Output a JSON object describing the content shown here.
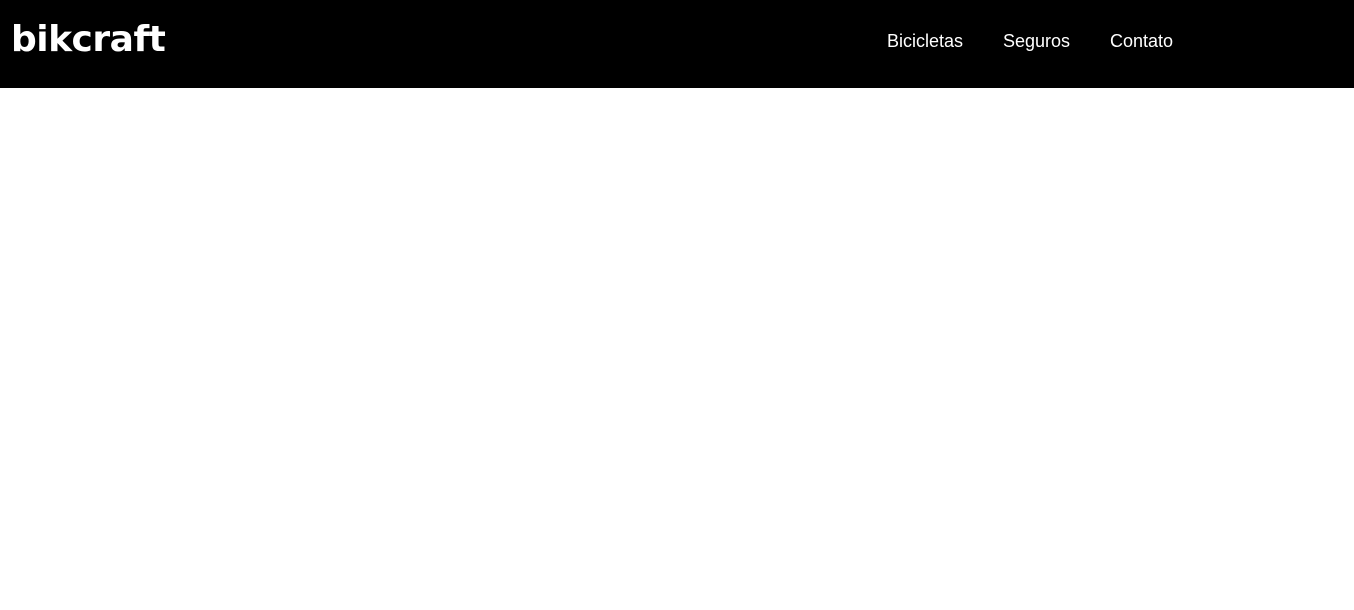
{
  "header": {
    "logo_text": "bikcraft",
    "background_color": "#000000",
    "text_color": "#ffffff"
  },
  "nav": {
    "items": [
      {
        "label": "Bicicletas"
      },
      {
        "label": "Seguros"
      },
      {
        "label": "Contato"
      }
    ]
  },
  "main": {
    "background_color": "#ffffff"
  }
}
